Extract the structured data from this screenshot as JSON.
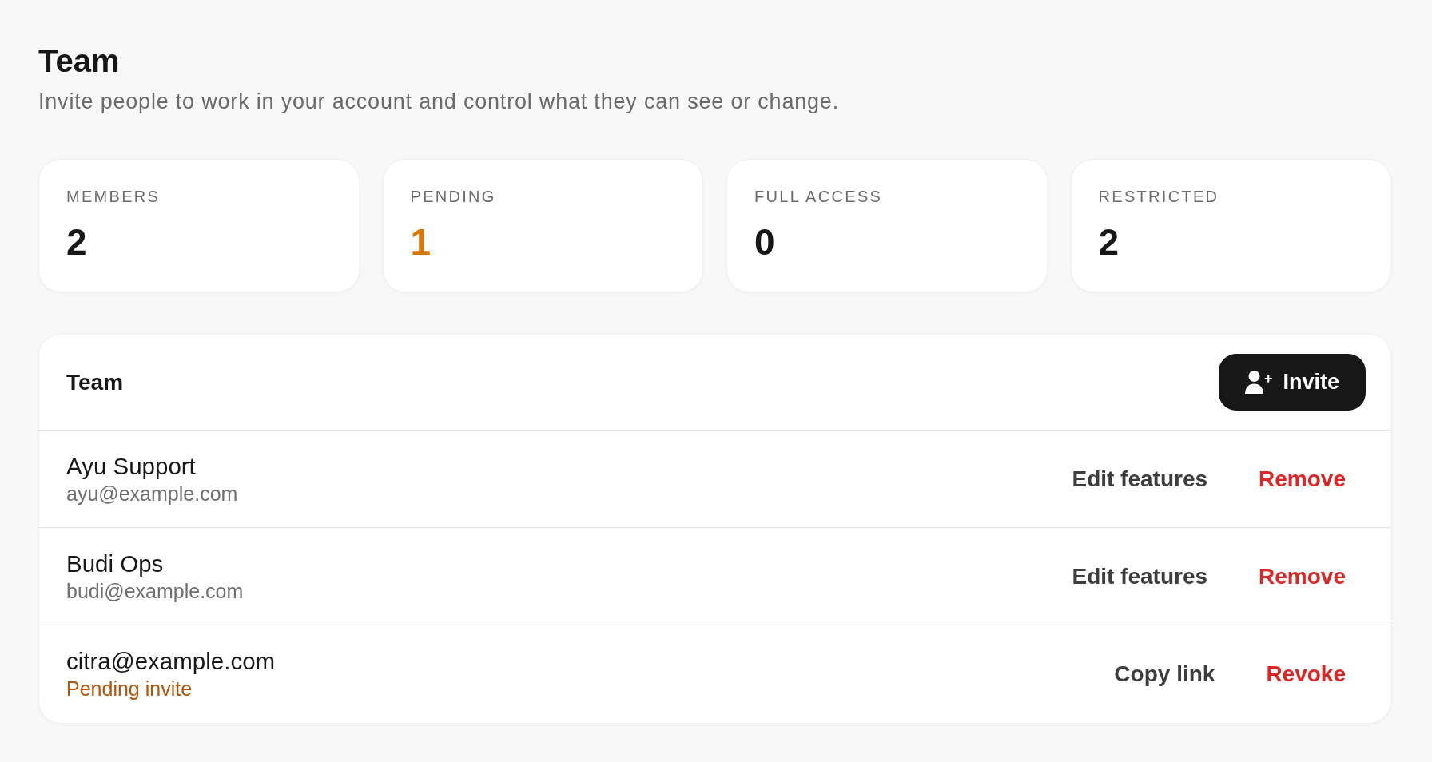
{
  "page": {
    "title": "Team",
    "subtitle": "Invite people to work in your account and control what they can see or change."
  },
  "stats": [
    {
      "label": "MEMBERS",
      "value": "2",
      "kind": "plain"
    },
    {
      "label": "PENDING",
      "value": "1",
      "kind": "warning"
    },
    {
      "label": "FULL ACCESS",
      "value": "0",
      "kind": "plain"
    },
    {
      "label": "RESTRICTED",
      "value": "2",
      "kind": "plain"
    }
  ],
  "team_panel": {
    "title": "Team",
    "invite_button": {
      "label": "Invite"
    },
    "rows": [
      {
        "kind": "member",
        "name": "Ayu Support",
        "email": "ayu@example.com",
        "actions": [
          {
            "label": "Edit features",
            "kind": "default"
          },
          {
            "label": "Remove",
            "kind": "danger"
          }
        ]
      },
      {
        "kind": "member",
        "name": "Budi Ops",
        "email": "budi@example.com",
        "actions": [
          {
            "label": "Edit features",
            "kind": "default"
          },
          {
            "label": "Remove",
            "kind": "danger"
          }
        ]
      },
      {
        "kind": "invite",
        "email": "citra@example.com",
        "status": "Pending invite",
        "actions": [
          {
            "label": "Copy link",
            "kind": "default"
          },
          {
            "label": "Revoke",
            "kind": "danger"
          }
        ]
      }
    ]
  }
}
